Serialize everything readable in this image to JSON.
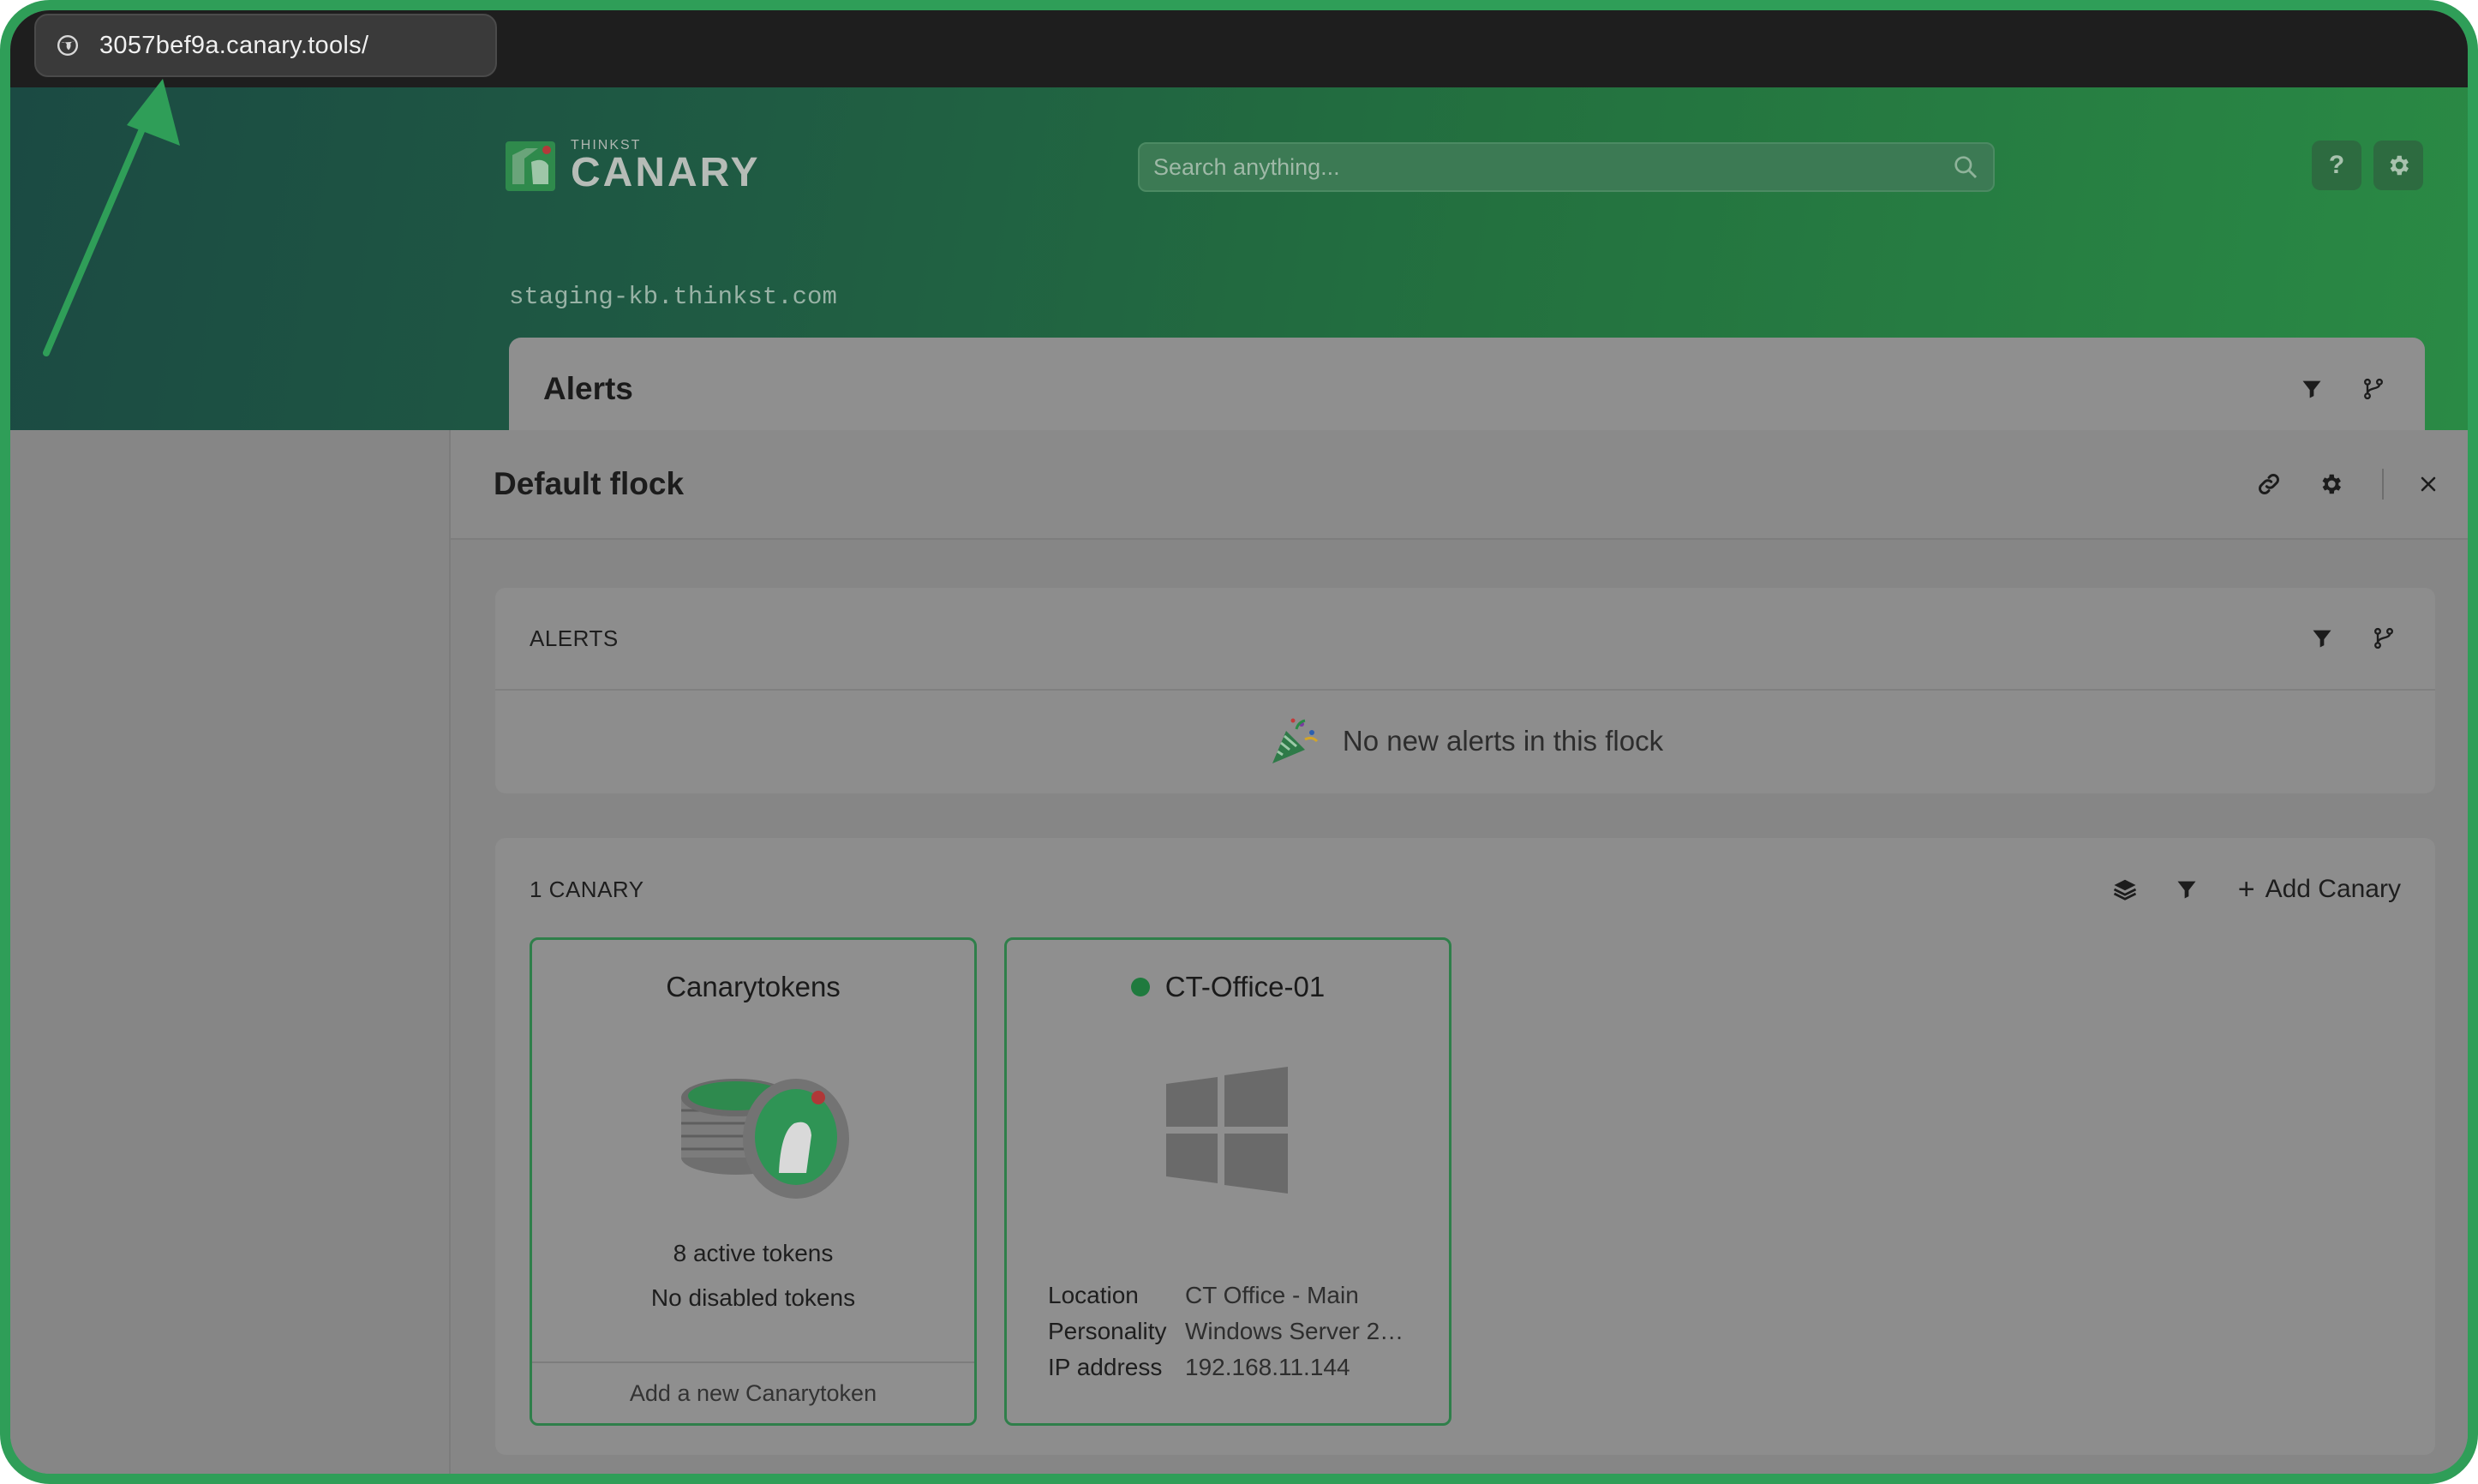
{
  "browser": {
    "url": "3057bef9a.canary.tools/"
  },
  "header": {
    "logo_small": "THINKST",
    "logo_big": "CANARY",
    "search_placeholder": "Search anything...",
    "help_label": "?",
    "domain": "staging-kb.thinkst.com",
    "alerts_title": "Alerts"
  },
  "panel": {
    "title": "Default flock",
    "alerts_section": {
      "title": "ALERTS",
      "empty_message": "No new alerts in this flock"
    },
    "canary_section": {
      "title": "1 CANARY",
      "add_label": "Add Canary"
    },
    "tokens_tile": {
      "title": "Canarytokens",
      "active": "8 active tokens",
      "disabled": "No disabled tokens",
      "footer": "Add a new Canarytoken"
    },
    "device_tile": {
      "name": "CT-Office-01",
      "status_color": "#1f7a3e",
      "rows": [
        {
          "key": "Location",
          "value": "CT Office - Main"
        },
        {
          "key": "Personality",
          "value": "Windows Server 2…"
        },
        {
          "key": "IP address",
          "value": "192.168.11.144"
        }
      ]
    }
  },
  "colors": {
    "accent": "#2f9e58",
    "header_gradient_start": "#1b4a43",
    "header_gradient_end": "#2a8a45"
  }
}
